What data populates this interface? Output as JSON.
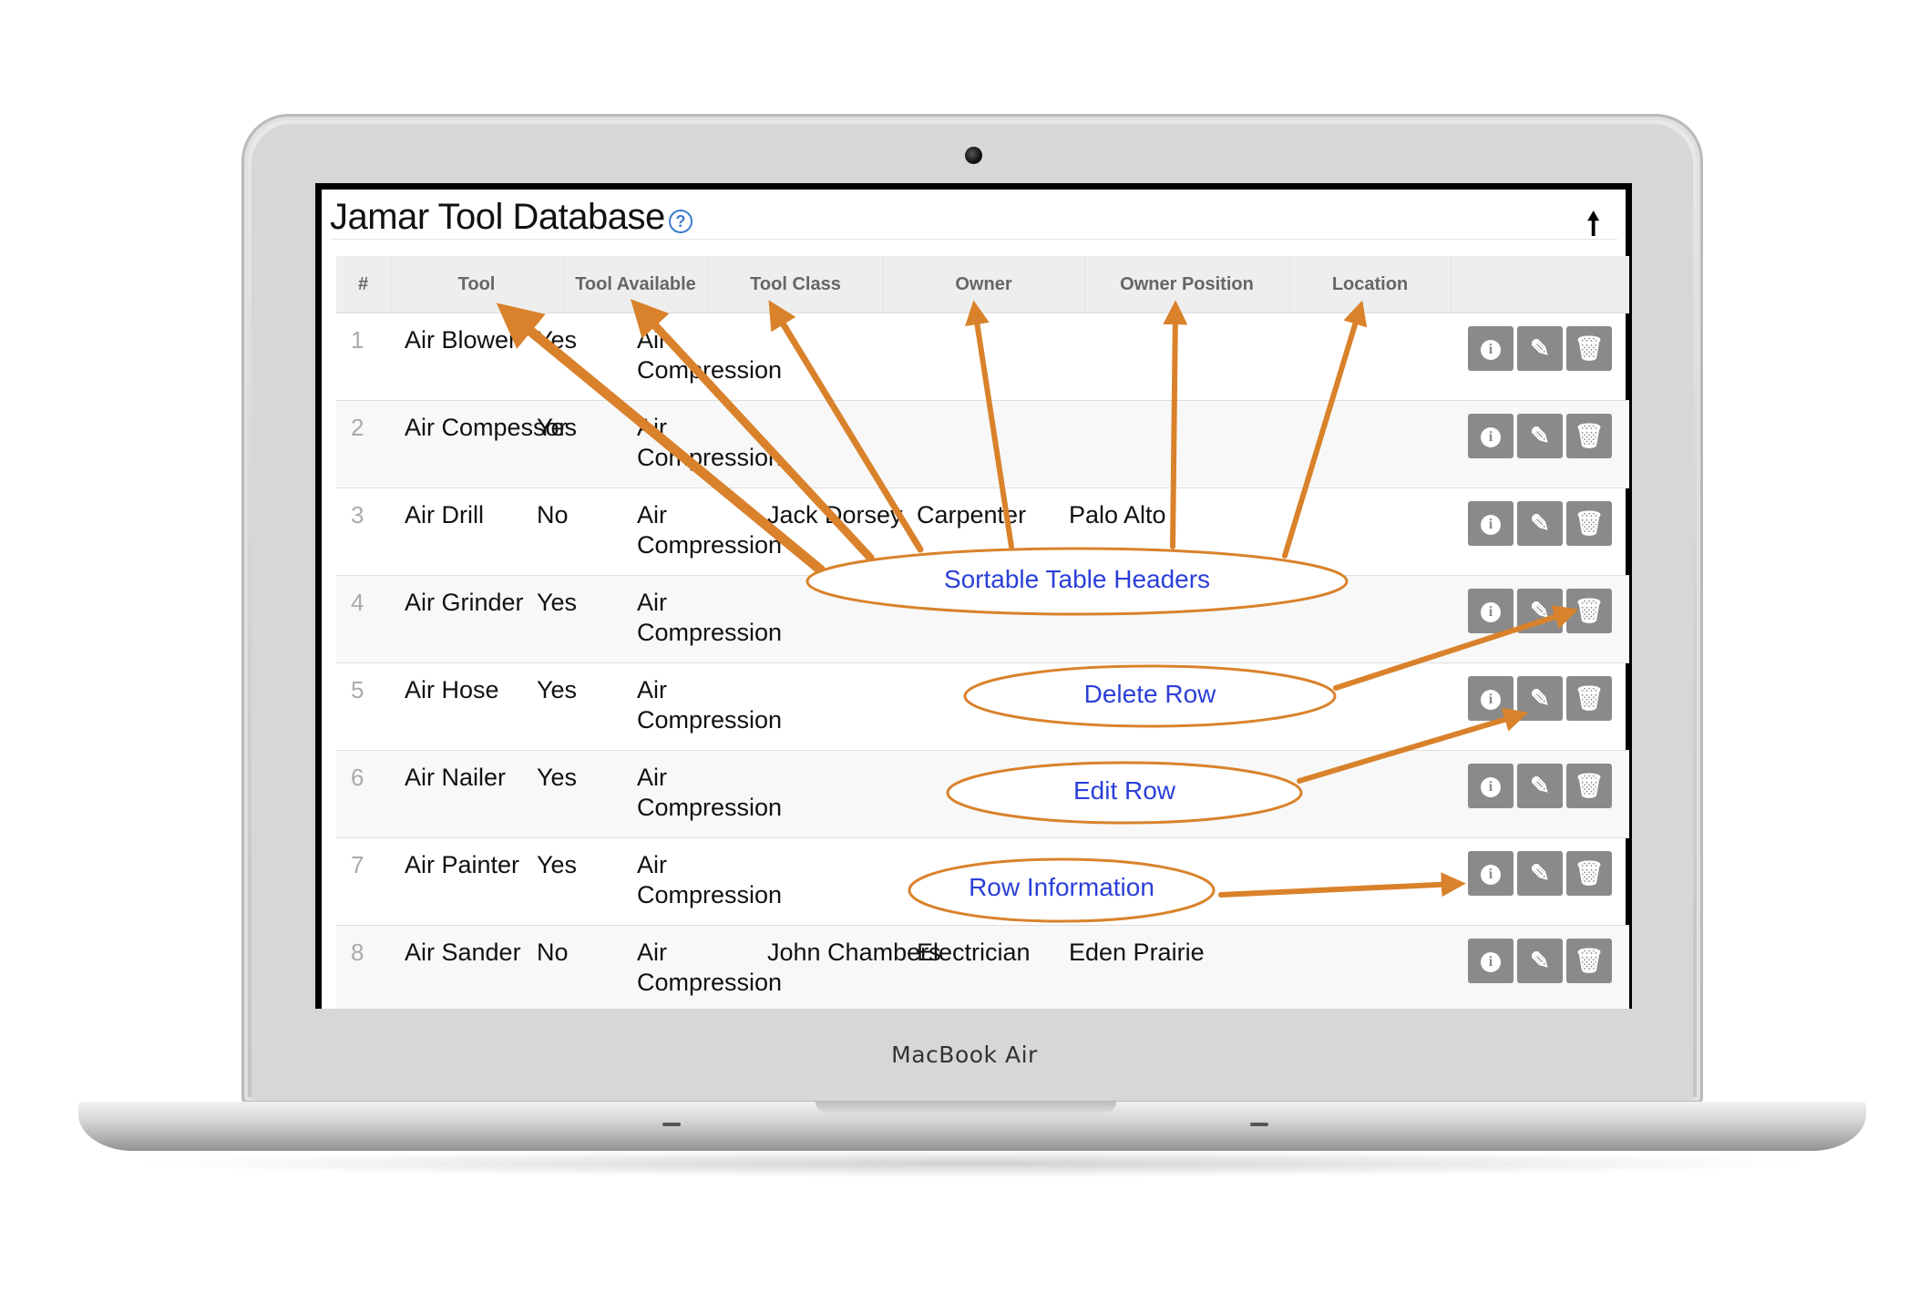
{
  "device": {
    "brand_label": "MacBook Air"
  },
  "app": {
    "title": "Jamar Tool Database"
  },
  "table": {
    "columns": [
      "#",
      "Tool",
      "Tool Available",
      "Tool Class",
      "Owner",
      "Owner Position",
      "Location"
    ],
    "rows": [
      {
        "num": "1",
        "tool": "Air Blower",
        "available": "Yes",
        "tool_class": "Air Compression",
        "owner": "",
        "position": "",
        "location": ""
      },
      {
        "num": "2",
        "tool": "Air Compessor",
        "available": "Yes",
        "tool_class": "Air Compression",
        "owner": "",
        "position": "",
        "location": ""
      },
      {
        "num": "3",
        "tool": "Air Drill",
        "available": "No",
        "tool_class": "Air Compression",
        "owner": "Jack Dorsey",
        "position": "Carpenter",
        "location": "Palo Alto"
      },
      {
        "num": "4",
        "tool": "Air Grinder",
        "available": "Yes",
        "tool_class": "Air Compression",
        "owner": "",
        "position": "",
        "location": ""
      },
      {
        "num": "5",
        "tool": "Air Hose",
        "available": "Yes",
        "tool_class": "Air Compression",
        "owner": "",
        "position": "",
        "location": ""
      },
      {
        "num": "6",
        "tool": "Air Nailer",
        "available": "Yes",
        "tool_class": "Air Compression",
        "owner": "",
        "position": "",
        "location": ""
      },
      {
        "num": "7",
        "tool": "Air Painter",
        "available": "Yes",
        "tool_class": "Air Compression",
        "owner": "",
        "position": "",
        "location": ""
      },
      {
        "num": "8",
        "tool": "Air Sander",
        "available": "No",
        "tool_class": "Air Compression",
        "owner": "John Chambers",
        "position": "Electrician",
        "location": "Eden Prairie"
      }
    ]
  },
  "annotations": {
    "sortable_headers": "Sortable Table Headers",
    "delete_row": "Delete Row",
    "edit_row": "Edit Row",
    "row_information": "Row Information"
  },
  "colors": {
    "annotation_orange": "#d9822b",
    "annotation_text": "#2b3fd8",
    "action_button": "#8a8a8a"
  }
}
